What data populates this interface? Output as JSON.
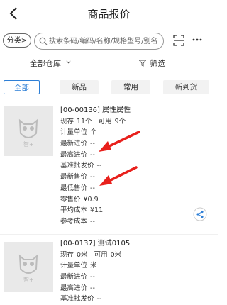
{
  "header": {
    "title": "商品报价"
  },
  "search": {
    "category_label": "分类>",
    "placeholder": "搜索条码/编码/名称/规格型号/别名"
  },
  "filters": {
    "warehouse_label": "全部仓库",
    "filter_label": "筛选"
  },
  "tabs": [
    {
      "label": "全部",
      "active": true
    },
    {
      "label": "新品",
      "active": false
    },
    {
      "label": "常用",
      "active": false
    },
    {
      "label": "新到货",
      "active": false
    }
  ],
  "products": [
    {
      "name": "[00-00136] 属性属性",
      "stock_label": "现存",
      "stock_value": "11个",
      "avail_label": "可用",
      "avail_value": "9个",
      "unit_label": "计量单位",
      "unit_value": "个",
      "latest_purchase_label": "最新进价",
      "latest_purchase_value": "--",
      "max_purchase_label": "最高进价",
      "max_purchase_value": "--",
      "wholesale_label": "基准批发价",
      "wholesale_value": "--",
      "latest_sale_label": "最新售价",
      "latest_sale_value": "--",
      "min_sale_label": "最低售价",
      "min_sale_value": "--",
      "retail_label": "零售价",
      "retail_value": "¥0.9",
      "avg_cost_label": "平均成本",
      "avg_cost_value": "¥11",
      "ref_cost_label": "参考成本",
      "ref_cost_value": "--",
      "thumb_text": "智+"
    },
    {
      "name": "[00-0137] 测试0105",
      "stock_label": "现存",
      "stock_value": "0米",
      "avail_label": "可用",
      "avail_value": "0米",
      "unit_label": "计量单位",
      "unit_value": "米",
      "latest_purchase_label": "最新进价",
      "latest_purchase_value": "--",
      "max_purchase_label": "最高进价",
      "max_purchase_value": "--",
      "wholesale_label": "基准批发价",
      "wholesale_value": "--",
      "thumb_text": "智+"
    }
  ],
  "colors": {
    "accent": "#2e7fd6",
    "arrow": "#e8201c"
  }
}
